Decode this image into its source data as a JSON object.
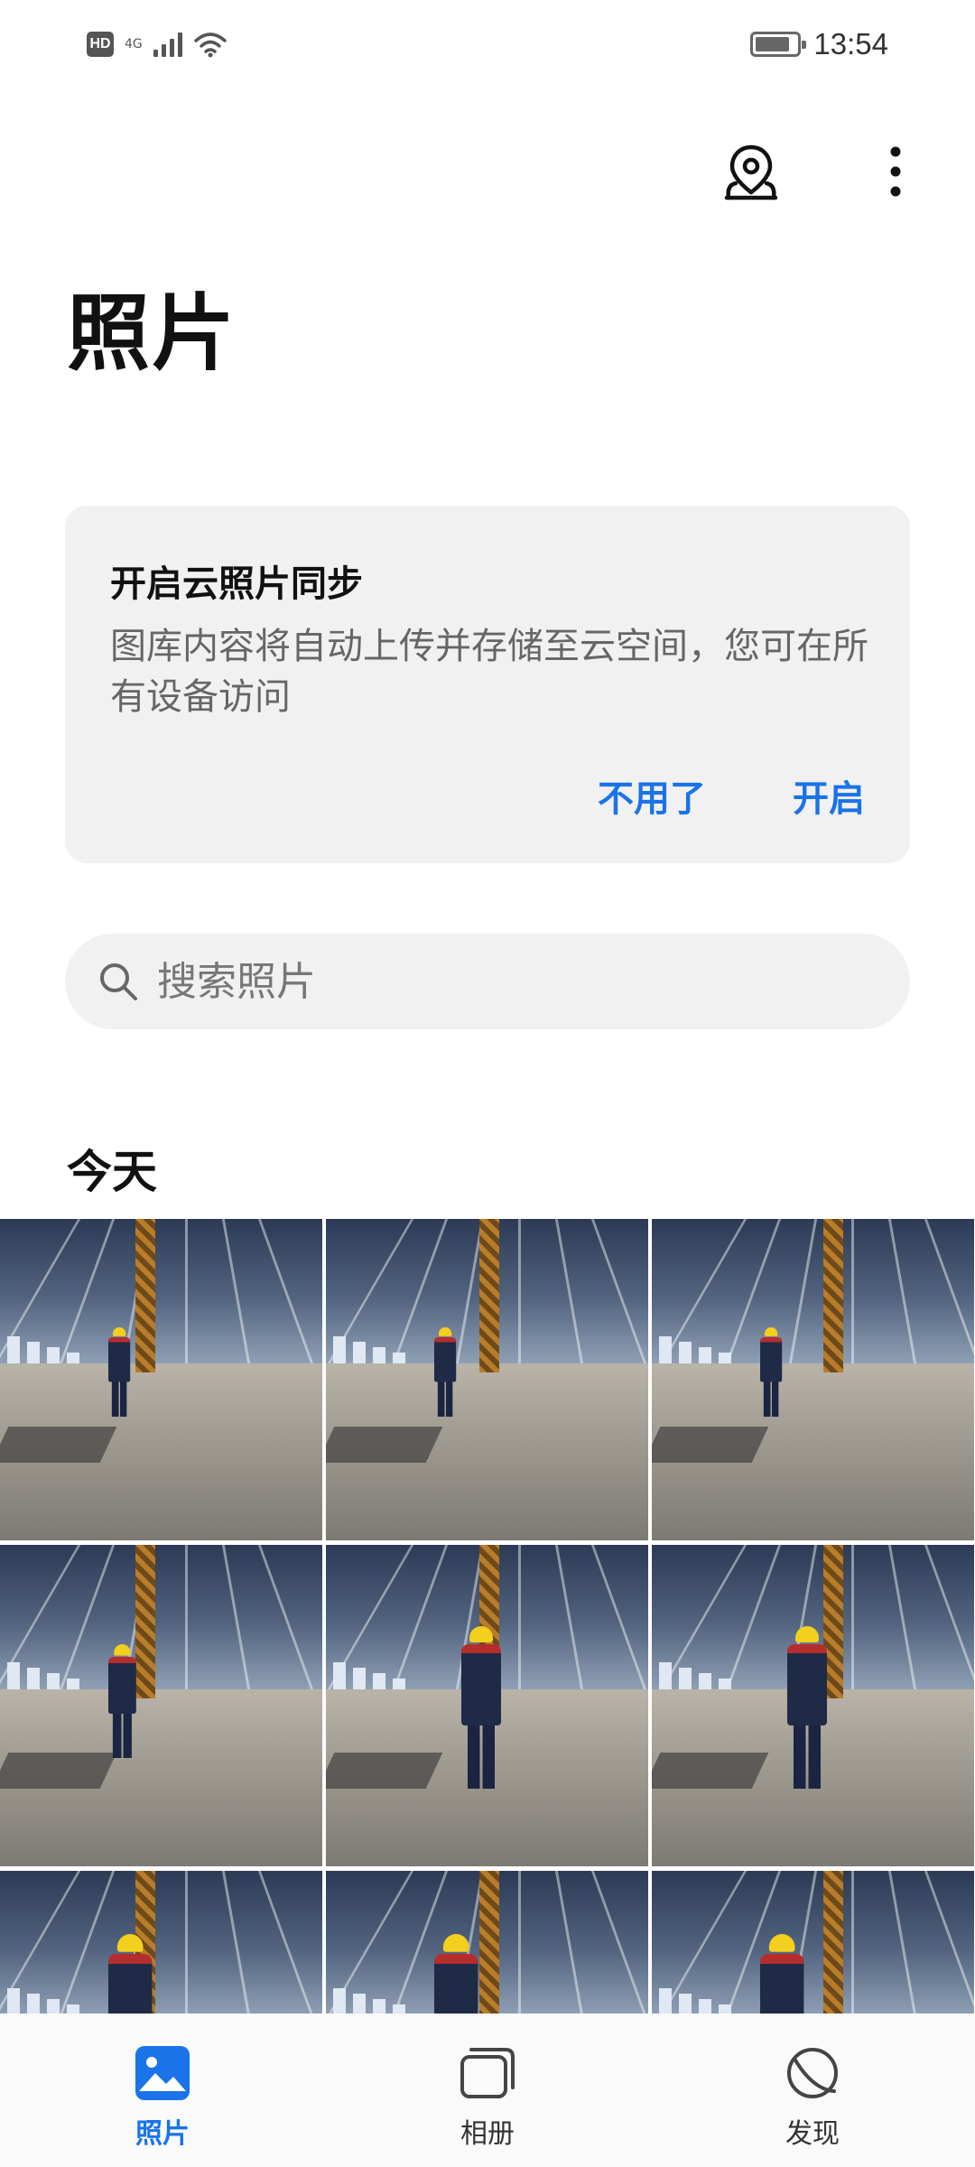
{
  "status_bar": {
    "hd": "HD",
    "network": "4G",
    "time": "13:54",
    "battery_level": 0.85
  },
  "header": {
    "title": "照片",
    "location_icon": "location-pin-icon",
    "more_icon": "more-vertical-icon"
  },
  "sync_card": {
    "title": "开启云照片同步",
    "description": "图库内容将自动上传并存储至云空间，您可在所有设备访问",
    "dismiss_label": "不用了",
    "enable_label": "开启"
  },
  "search": {
    "placeholder": "搜索照片",
    "icon": "search-icon"
  },
  "section": {
    "label": "今天"
  },
  "photos": {
    "count_visible": 9
  },
  "bottom_nav": {
    "items": [
      {
        "label": "照片",
        "icon": "photos-icon",
        "active": true
      },
      {
        "label": "相册",
        "icon": "albums-icon",
        "active": false
      },
      {
        "label": "发现",
        "icon": "discover-icon",
        "active": false
      }
    ]
  },
  "colors": {
    "accent": "#1a73e8",
    "card_bg": "#f1f1f1"
  }
}
